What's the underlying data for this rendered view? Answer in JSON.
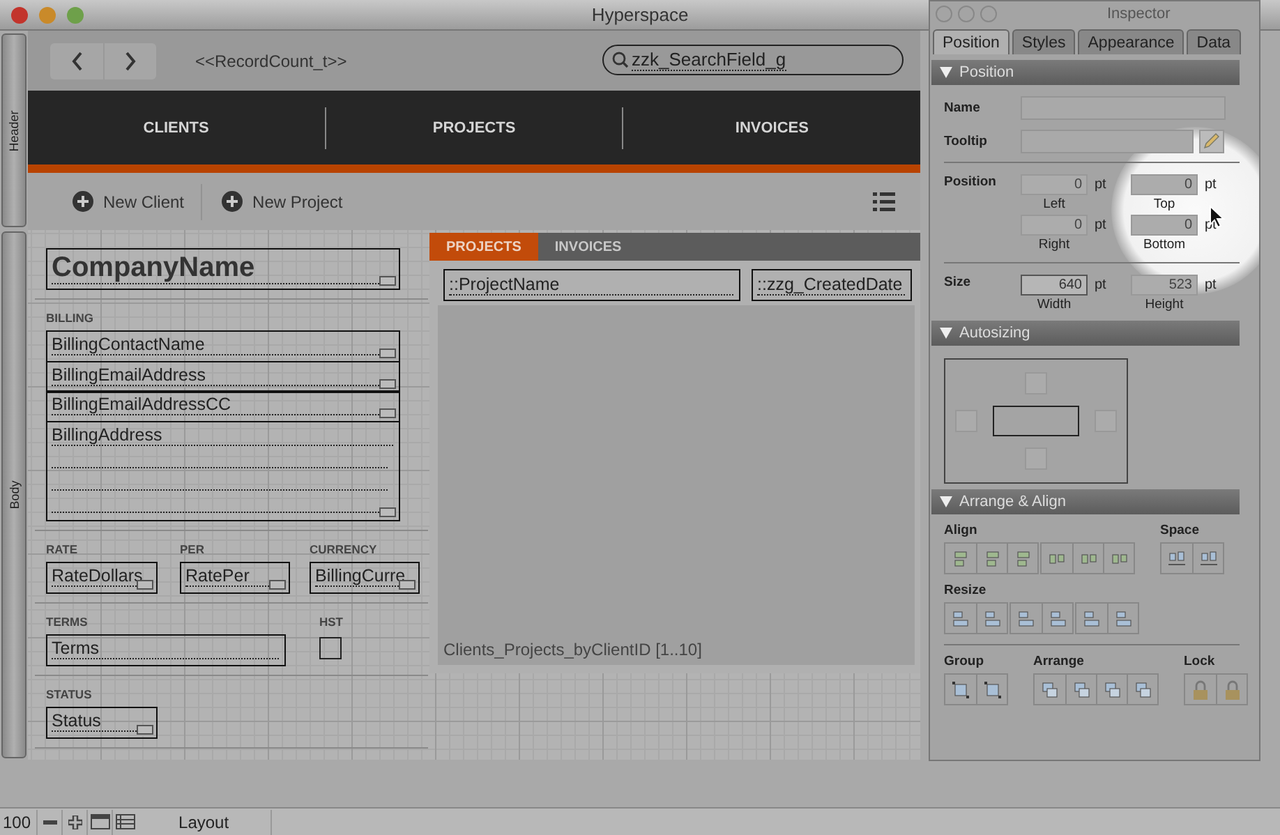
{
  "window": {
    "title": "Hyperspace"
  },
  "part_labels": [
    {
      "label": "Header"
    },
    {
      "label": "Body"
    }
  ],
  "header": {
    "record_count": "<<RecordCount_t>>",
    "search_field": {
      "value": "zzk_SearchField_g"
    },
    "nav_tabs": [
      {
        "label": "CLIENTS"
      },
      {
        "label": "PROJECTS"
      },
      {
        "label": "INVOICES"
      }
    ],
    "toolbar_buttons": [
      {
        "label": "New Client"
      },
      {
        "label": "New Project"
      }
    ]
  },
  "form": {
    "company_field": "CompanyName",
    "billing_label": "BILLING",
    "billing_fields": [
      "BillingContactName",
      "BillingEmailAddress",
      "BillingEmailAddressCC"
    ],
    "address_field": "BillingAddress",
    "rate_fields": [
      {
        "label": "RATE",
        "value": "RateDollars"
      },
      {
        "label": "PER",
        "value": "RatePer"
      },
      {
        "label": "CURRENCY",
        "value": "BillingCurre"
      }
    ],
    "terms": {
      "label": "TERMS",
      "value": "Terms"
    },
    "hst": {
      "label": "HST",
      "checked": false
    },
    "status": {
      "label": "STATUS",
      "value": "Status"
    }
  },
  "portal": {
    "tabs": [
      {
        "label": "PROJECTS",
        "selected": true
      },
      {
        "label": "INVOICES",
        "selected": false
      }
    ],
    "fields": [
      {
        "value": "::ProjectName"
      },
      {
        "value": "::zzg_CreatedDate"
      }
    ],
    "caption": "Clients_Projects_byClientID [1..10]"
  },
  "status_bar": {
    "zoom": "100",
    "mode": "Layout"
  },
  "inspector": {
    "title": "Inspector",
    "tabs": [
      {
        "label": "Position",
        "selected": true
      },
      {
        "label": "Styles",
        "selected": false
      },
      {
        "label": "Appearance",
        "selected": false
      },
      {
        "label": "Data",
        "selected": false
      }
    ],
    "position_section": {
      "title": "Position",
      "name_label": "Name",
      "tooltip_label": "Tooltip",
      "position_label": "Position",
      "position_fields": [
        {
          "value": "0",
          "unit": "pt",
          "caption": "Left",
          "disabled": true
        },
        {
          "value": "0",
          "unit": "pt",
          "caption": "Top",
          "disabled": true
        },
        {
          "value": "0",
          "unit": "pt",
          "caption": "Right",
          "disabled": true
        },
        {
          "value": "0",
          "unit": "pt",
          "caption": "Bottom",
          "disabled": true
        }
      ],
      "size_label": "Size",
      "size_fields": [
        {
          "value": "640",
          "unit": "pt",
          "caption": "Width",
          "disabled": false
        },
        {
          "value": "523",
          "unit": "pt",
          "caption": "Height",
          "disabled": true
        }
      ]
    },
    "autosizing_section": {
      "title": "Autosizing"
    },
    "arrange_section": {
      "title": "Arrange & Align",
      "align_label": "Align",
      "space_label": "Space",
      "resize_label": "Resize",
      "group_label": "Group",
      "arrange_label": "Arrange",
      "lock_label": "Lock"
    }
  }
}
